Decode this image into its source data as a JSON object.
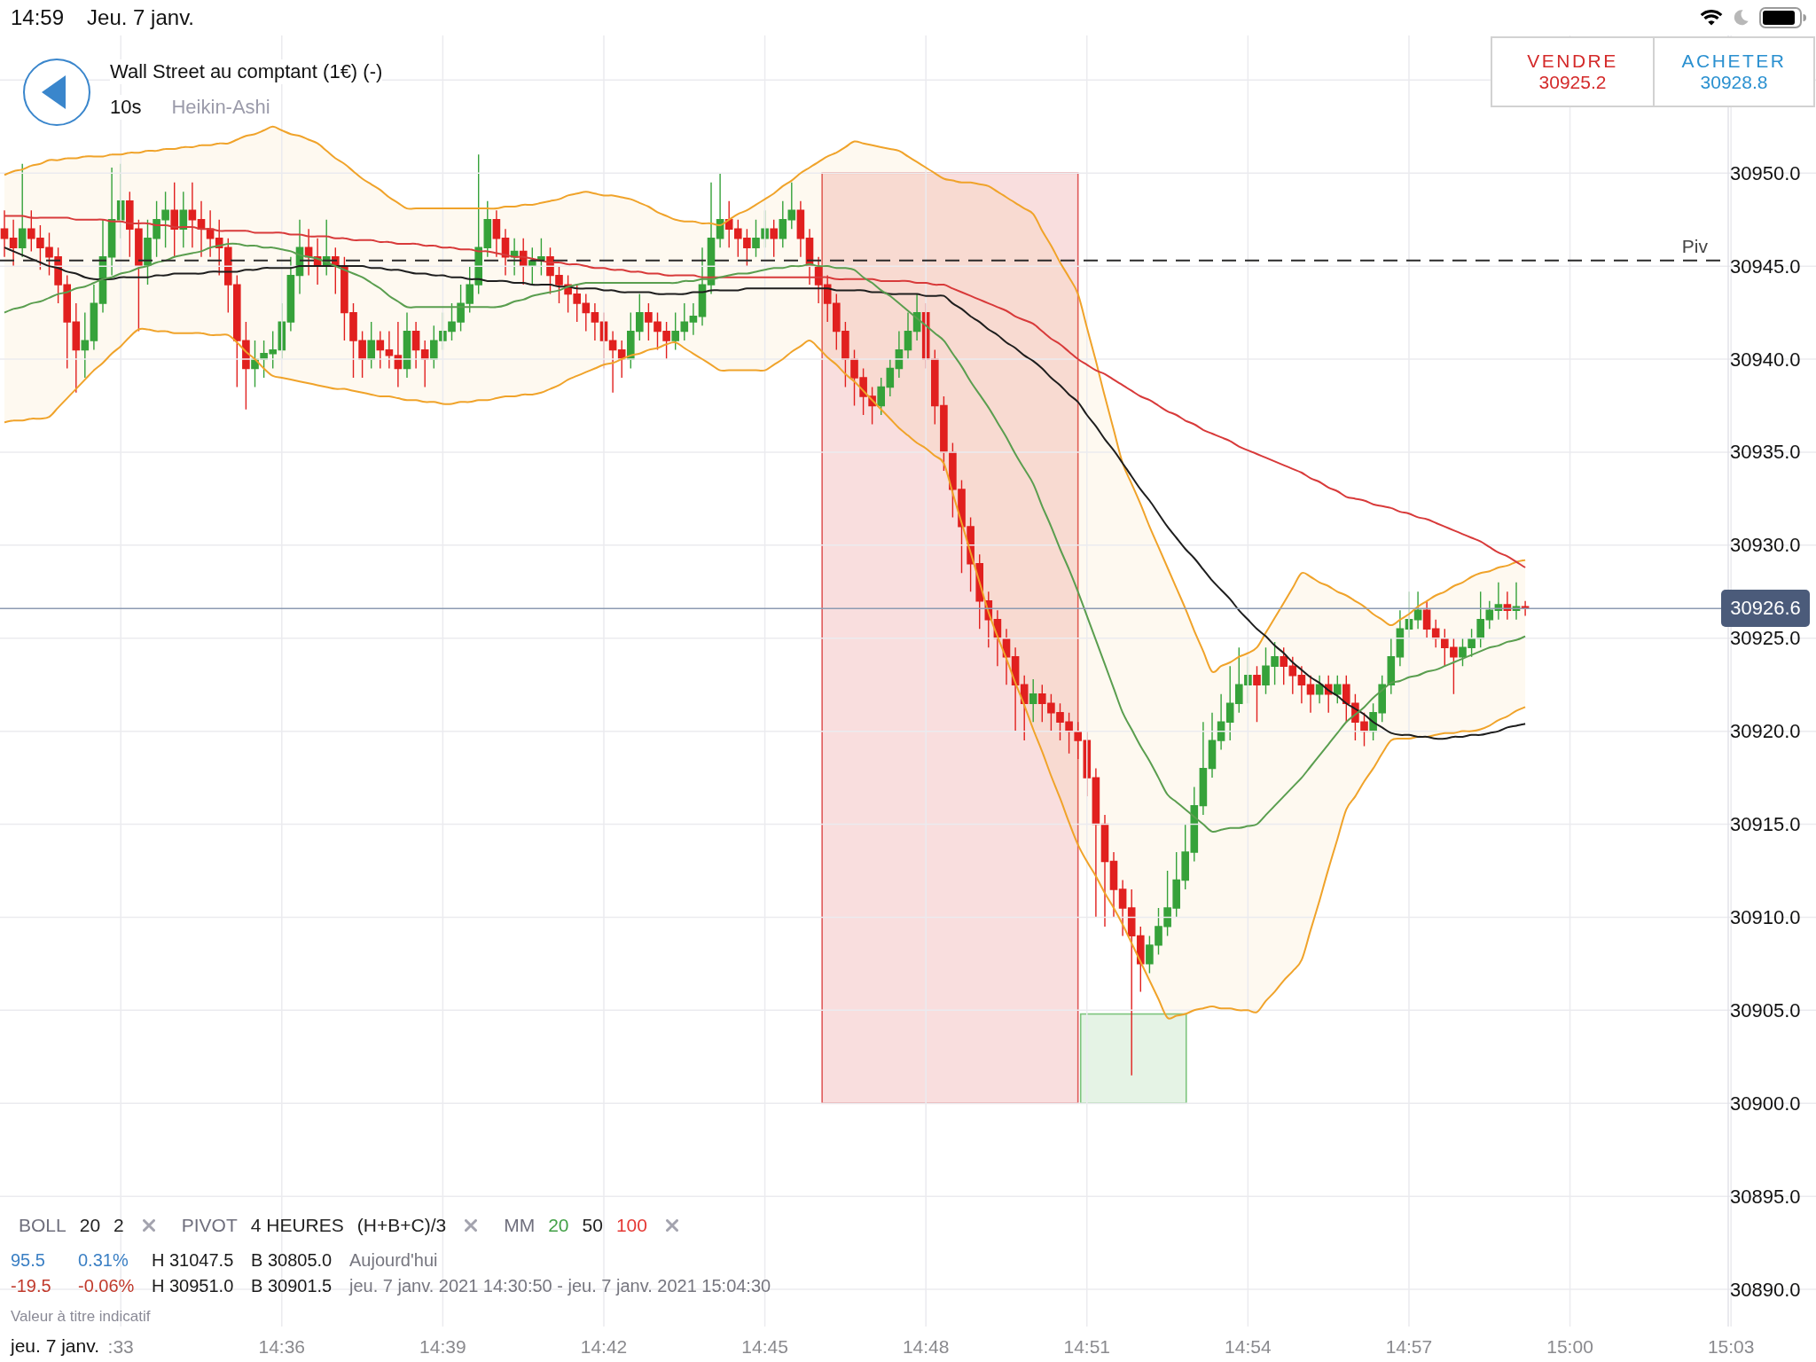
{
  "status_bar": {
    "time": "14:59",
    "date": "Jeu. 7 janv."
  },
  "instrument": {
    "title": "Wall Street au comptant (1€) (-)",
    "interval": "10s",
    "chart_type": "Heikin-Ashi"
  },
  "trade_buttons": [
    {
      "kind": "sell",
      "label": "VENDRE",
      "price": "30925.2"
    },
    {
      "kind": "buy",
      "label": "ACHETER",
      "price": "30928.8"
    }
  ],
  "chart": {
    "chart_data": {
      "type": "line",
      "grid": true,
      "categories": [
        null,
        null,
        null,
        null,
        null,
        null,
        null,
        null,
        null,
        null,
        null,
        null,
        null,
        ":33",
        null,
        null,
        null,
        null,
        null,
        null,
        null,
        null,
        null,
        null,
        null,
        null,
        null,
        null,
        null,
        null,
        null,
        "14:36",
        null,
        null,
        null,
        null,
        null,
        null,
        null,
        null,
        null,
        null,
        null,
        null,
        null,
        null,
        null,
        null,
        null,
        "14:39",
        null,
        null,
        null,
        null,
        null,
        null,
        null,
        null,
        null,
        null,
        null,
        null,
        null,
        null,
        null,
        null,
        null,
        "14:42",
        null,
        null,
        null,
        null,
        null,
        null,
        null,
        null,
        null,
        null,
        null,
        null,
        null,
        null,
        null,
        null,
        null,
        "14:45",
        null,
        null,
        null,
        null,
        null,
        null,
        null,
        null,
        null,
        null,
        null,
        null,
        null,
        null,
        null,
        null,
        null,
        "14:48",
        null,
        null,
        null,
        null,
        null,
        null,
        null,
        null,
        null,
        null,
        null,
        null,
        null,
        null,
        null,
        null,
        null,
        "14:51",
        null,
        null,
        null,
        null,
        null,
        null,
        null,
        null,
        null,
        null,
        null,
        null,
        null,
        null,
        null,
        null,
        null,
        "14:54",
        null,
        null,
        null,
        null,
        null,
        null,
        null,
        null,
        null,
        null,
        null,
        null,
        null,
        null,
        null,
        null,
        null,
        "14:57",
        null,
        null,
        null,
        null,
        null,
        null,
        null,
        null,
        null,
        null,
        null,
        null,
        null,
        null,
        null,
        null,
        null,
        "15:00",
        null,
        null,
        null,
        null,
        null,
        null,
        null,
        null,
        null,
        null,
        null,
        null,
        null,
        null,
        null,
        null,
        null,
        "15:03",
        null,
        null,
        null,
        null,
        null,
        null,
        null,
        null,
        null
      ],
      "ylim": [
        30888,
        30957.4
      ],
      "yticks": [
        {
          "value": 30950,
          "label": "30950.0"
        },
        {
          "value": 30945,
          "label": "30945.0"
        },
        {
          "value": 30940,
          "label": "30940.0"
        },
        {
          "value": 30935,
          "label": "30935.0"
        },
        {
          "value": 30930,
          "label": "30930.0"
        },
        {
          "value": 30925,
          "label": "30925.0"
        },
        {
          "value": 30920,
          "label": "30920.0"
        },
        {
          "value": 30915,
          "label": "30915.0"
        },
        {
          "value": 30910,
          "label": "30910.0"
        },
        {
          "value": 30905,
          "label": "30905.0"
        },
        {
          "value": 30900,
          "label": "30900.0"
        },
        {
          "value": 30895,
          "label": "30895.0"
        },
        {
          "value": 30890,
          "label": "30890.0"
        }
      ],
      "series": [
        {
          "color": "#f0a32a",
          "values": [
            30949.9,
            30950.1,
            30950.2,
            30950.4,
            30950.5,
            30950.7,
            30950.7,
            30950.8,
            30950.8,
            30950.9,
            30950.9,
            30950.9,
            30951.0,
            30951.0,
            30951.1,
            30951.1,
            30951.2,
            30951.2,
            30951.3,
            30951.3,
            30951.4,
            30951.4,
            30951.5,
            30951.5,
            30951.6,
            30951.6,
            30951.8,
            30952.0,
            30952.1,
            30952.3,
            30952.5,
            30952.3,
            30952.1,
            30952.0,
            30951.8,
            30951.6,
            30951.2,
            30950.8,
            30950.5,
            30950.1,
            30949.7,
            30949.4,
            30949.1,
            30948.7,
            30948.4,
            30948.1,
            30948.1,
            30948.1,
            30948.1,
            30948.1,
            30948.1,
            30948.1,
            30948.1,
            30948.1,
            30948.1,
            30948.1,
            30948.2,
            30948.2,
            30948.3,
            30948.3,
            30948.4,
            30948.5,
            30948.6,
            30948.8,
            30948.9,
            30949.0,
            30948.9,
            30948.8,
            30948.8,
            30948.7,
            30948.6,
            30948.4,
            30948.2,
            30947.9,
            30947.7,
            30947.5,
            30947.4,
            30947.4,
            30947.3,
            30947.3,
            30947.2,
            30947.5,
            30947.8,
            30948.0,
            30948.3,
            30948.6,
            30948.9,
            30949.3,
            30949.6,
            30950.0,
            30950.3,
            30950.6,
            30950.9,
            30951.1,
            30951.4,
            30951.7,
            30951.6,
            30951.5,
            30951.4,
            30951.3,
            30951.2,
            30950.9,
            30950.6,
            30950.3,
            30950.0,
            30949.7,
            30949.6,
            30949.5,
            30949.5,
            30949.4,
            30949.3,
            30949.0,
            30948.7,
            30948.4,
            30948.1,
            30947.8,
            30946.9,
            30946.1,
            30945.2,
            30944.4,
            30943.5,
            30941.7,
            30939.9,
            30938.0,
            30936.2,
            30934.4,
            30933.3,
            30932.2,
            30931.0,
            30929.9,
            30928.8,
            30927.7,
            30926.6,
            30925.4,
            30924.3,
            30923.2,
            30923.5,
            30923.7,
            30924.0,
            30924.2,
            30924.5,
            30925.3,
            30926.1,
            30926.9,
            30927.7,
            30928.5,
            30928.3,
            30928.0,
            30927.8,
            30927.5,
            30927.3,
            30927.0,
            30926.7,
            30926.3,
            30926.0,
            30925.7,
            30926.0,
            30926.3,
            30926.7,
            30927.0,
            30927.3,
            30927.5,
            30927.8,
            30928.0,
            30928.3,
            30928.5,
            30928.6,
            30928.8,
            30928.9,
            30929.1,
            30929.2,
            null,
            null,
            null,
            null,
            null,
            null,
            null,
            null,
            null,
            null,
            null,
            null,
            null,
            null,
            null,
            null,
            null,
            null,
            null,
            null,
            null,
            null,
            null,
            null,
            null,
            null,
            null,
            null,
            null,
            null,
            null,
            null
          ]
        },
        {
          "color": "#f0a32a",
          "values": [
            30936.6,
            30936.7,
            30936.7,
            30936.8,
            30936.8,
            30936.9,
            30937.4,
            30937.9,
            30938.4,
            30938.9,
            30939.4,
            30939.8,
            30940.3,
            30940.7,
            30941.2,
            30941.6,
            30941.6,
            30941.5,
            30941.5,
            30941.4,
            30941.4,
            30941.4,
            30941.4,
            30941.3,
            30941.3,
            30941.3,
            30940.9,
            30940.4,
            30940.0,
            30939.5,
            30939.1,
            30939.0,
            30938.9,
            30938.8,
            30938.7,
            30938.6,
            30938.5,
            30938.4,
            30938.4,
            30938.3,
            30938.2,
            30938.1,
            30938.0,
            30938.0,
            30937.9,
            30937.8,
            30937.8,
            30937.7,
            30937.7,
            30937.6,
            30937.6,
            30937.7,
            30937.7,
            30937.8,
            30937.8,
            30937.9,
            30938.0,
            30938.0,
            30938.1,
            30938.1,
            30938.2,
            30938.4,
            30938.6,
            30938.9,
            30939.1,
            30939.3,
            30939.5,
            30939.7,
            30939.8,
            30940.0,
            30940.2,
            30940.3,
            30940.5,
            30940.6,
            30940.8,
            30940.9,
            30940.6,
            30940.3,
            30940.0,
            30939.7,
            30939.4,
            30939.4,
            30939.4,
            30939.4,
            30939.4,
            30939.4,
            30939.7,
            30940.0,
            30940.4,
            30940.7,
            30941.0,
            30940.6,
            30940.1,
            30939.7,
            30939.2,
            30938.8,
            30938.3,
            30937.8,
            30937.3,
            30936.8,
            30936.3,
            30935.9,
            30935.5,
            30935.2,
            30934.8,
            30934.4,
            30932.8,
            30931.2,
            30929.6,
            30928.0,
            30926.4,
            30925.1,
            30923.9,
            30922.6,
            30921.4,
            30920.1,
            30918.9,
            30917.6,
            30916.4,
            30915.1,
            30913.9,
            30913.0,
            30912.2,
            30911.3,
            30910.5,
            30909.6,
            30908.6,
            30907.6,
            30906.6,
            30905.6,
            30904.6,
            30904.7,
            30904.8,
            30905.0,
            30905.1,
            30905.2,
            30905.1,
            30905.1,
            30905.0,
            30905.0,
            30904.9,
            30905.5,
            30906.0,
            30906.6,
            30907.1,
            30907.7,
            30909.3,
            30910.9,
            30912.6,
            30914.2,
            30915.8,
            30916.5,
            30917.3,
            30918.0,
            30918.8,
            30919.5,
            30919.6,
            30919.6,
            30919.7,
            30919.7,
            30919.8,
            30919.9,
            30919.9,
            30920.0,
            30920.0,
            30920.1,
            30920.3,
            30920.6,
            30920.8,
            30921.1,
            30921.3,
            null,
            null,
            null,
            null,
            null,
            null,
            null,
            null,
            null,
            null,
            null,
            null,
            null,
            null,
            null,
            null,
            null,
            null,
            null,
            null,
            null,
            null,
            null,
            null,
            null,
            null,
            null,
            null,
            null,
            null,
            null,
            null
          ]
        },
        {
          "color": "#d83a3a",
          "values": [
            30947.7,
            30947.7,
            30947.7,
            30947.6,
            30947.6,
            30947.6,
            30947.6,
            30947.6,
            30947.5,
            30947.5,
            30947.5,
            30947.5,
            30947.4,
            30947.4,
            30947.3,
            30947.3,
            30947.3,
            30947.2,
            30947.2,
            30947.1,
            30947.1,
            30947.1,
            30947.0,
            30947.0,
            30946.9,
            30946.9,
            30946.9,
            30946.9,
            30946.8,
            30946.8,
            30946.8,
            30946.8,
            30946.7,
            30946.7,
            30946.6,
            30946.6,
            30946.6,
            30946.5,
            30946.5,
            30946.4,
            30946.4,
            30946.4,
            30946.3,
            30946.3,
            30946.2,
            30946.2,
            30946.2,
            30946.1,
            30946.1,
            30946.0,
            30946.0,
            30945.9,
            30945.9,
            30945.8,
            30945.8,
            30945.7,
            30945.6,
            30945.5,
            30945.5,
            30945.4,
            30945.3,
            30945.2,
            30945.2,
            30945.1,
            30945.1,
            30945.0,
            30944.9,
            30944.9,
            30944.8,
            30944.8,
            30944.7,
            30944.7,
            30944.6,
            30944.6,
            30944.5,
            30944.5,
            30944.5,
            30944.5,
            30944.4,
            30944.4,
            30944.4,
            30944.4,
            30944.4,
            30944.4,
            30944.4,
            30944.4,
            30944.4,
            30944.4,
            30944.4,
            30944.4,
            30944.4,
            30944.4,
            30944.4,
            30944.3,
            30944.3,
            30944.3,
            30944.3,
            30944.3,
            30944.2,
            30944.2,
            30944.2,
            30944.2,
            30944.1,
            30944.1,
            30944.0,
            30944.0,
            30943.8,
            30943.6,
            30943.4,
            30943.2,
            30943.0,
            30942.8,
            30942.6,
            30942.3,
            30942.1,
            30941.9,
            30941.5,
            30941.1,
            30940.8,
            30940.4,
            30940.0,
            30939.7,
            30939.4,
            30939.2,
            30938.9,
            30938.6,
            30938.3,
            30938.0,
            30937.8,
            30937.5,
            30937.2,
            30937.0,
            30936.7,
            30936.5,
            30936.2,
            30936.0,
            30935.8,
            30935.6,
            30935.3,
            30935.1,
            30934.9,
            30934.7,
            30934.5,
            30934.3,
            30934.1,
            30933.9,
            30933.6,
            30933.4,
            30933.1,
            30932.9,
            30932.6,
            30932.5,
            30932.4,
            30932.2,
            30932.1,
            30932.0,
            30931.8,
            30931.7,
            30931.5,
            30931.4,
            30931.2,
            30931.0,
            30930.8,
            30930.6,
            30930.4,
            30930.2,
            30929.9,
            30929.6,
            30929.4,
            30929.1,
            30928.8,
            null,
            null,
            null,
            null,
            null,
            null,
            null,
            null,
            null,
            null,
            null,
            null,
            null,
            null,
            null,
            null,
            null,
            null,
            null,
            null,
            null,
            null,
            null,
            null,
            null,
            null,
            null,
            null,
            null,
            null,
            null,
            null
          ]
        },
        {
          "color": "#1e1e1e",
          "values": [
            30946.0,
            30945.8,
            30945.6,
            30945.4,
            30945.2,
            30945.0,
            30944.9,
            30944.7,
            30944.6,
            30944.4,
            30944.3,
            30944.3,
            30944.3,
            30944.4,
            30944.4,
            30944.4,
            30944.4,
            30944.5,
            30944.5,
            30944.6,
            30944.6,
            30944.6,
            30944.6,
            30944.7,
            30944.7,
            30944.7,
            30944.7,
            30944.8,
            30944.8,
            30944.9,
            30944.9,
            30944.9,
            30944.9,
            30945.0,
            30945.0,
            30945.0,
            30945.0,
            30945.0,
            30945.0,
            30945.0,
            30945.0,
            30944.9,
            30944.9,
            30944.8,
            30944.8,
            30944.7,
            30944.6,
            30944.6,
            30944.5,
            30944.5,
            30944.4,
            30944.4,
            30944.3,
            30944.3,
            30944.2,
            30944.2,
            30944.2,
            30944.1,
            30944.1,
            30944.0,
            30944.0,
            30944.0,
            30943.9,
            30943.9,
            30943.8,
            30943.8,
            30943.8,
            30943.7,
            30943.7,
            30943.6,
            30943.6,
            30943.6,
            30943.6,
            30943.5,
            30943.5,
            30943.5,
            30943.5,
            30943.6,
            30943.6,
            30943.7,
            30943.7,
            30943.7,
            30943.7,
            30943.8,
            30943.8,
            30943.8,
            30943.8,
            30943.8,
            30943.8,
            30943.8,
            30943.8,
            30943.8,
            30943.8,
            30943.7,
            30943.7,
            30943.7,
            30943.7,
            30943.6,
            30943.6,
            30943.5,
            30943.5,
            30943.5,
            30943.5,
            30943.4,
            30943.4,
            30943.4,
            30943.0,
            30942.7,
            30942.3,
            30942.0,
            30941.6,
            30941.3,
            30940.9,
            30940.6,
            30940.2,
            30939.9,
            30939.5,
            30939.0,
            30938.6,
            30938.1,
            30937.7,
            30937.0,
            30936.4,
            30935.7,
            30935.1,
            30934.4,
            30933.7,
            30933.0,
            30932.4,
            30931.7,
            30931.0,
            30930.4,
            30929.8,
            30929.3,
            30928.7,
            30928.1,
            30927.6,
            30927.1,
            30926.5,
            30926.0,
            30925.5,
            30925.1,
            30924.6,
            30924.2,
            30923.7,
            30923.3,
            30922.9,
            30922.6,
            30922.2,
            30921.9,
            30921.5,
            30921.2,
            30920.9,
            30920.5,
            30920.2,
            30919.9,
            30919.8,
            30919.8,
            30919.7,
            30919.7,
            30919.6,
            30919.6,
            30919.7,
            30919.7,
            30919.8,
            30919.8,
            30919.9,
            30920.0,
            30920.2,
            30920.3,
            30920.4,
            null,
            null,
            null,
            null,
            null,
            null,
            null,
            null,
            null,
            null,
            null,
            null,
            null,
            null,
            null,
            null,
            null,
            null,
            null,
            null,
            null,
            null,
            null,
            null,
            null,
            null,
            null,
            null,
            null,
            null,
            null,
            null
          ]
        },
        {
          "color": "#5a9e4f",
          "values": [
            30942.5,
            30942.7,
            30942.8,
            30943.0,
            30943.1,
            30943.3,
            30943.5,
            30943.6,
            30943.8,
            30943.9,
            30944.1,
            30944.3,
            30944.4,
            30944.6,
            30944.7,
            30944.9,
            30945.0,
            30945.2,
            30945.3,
            30945.5,
            30945.6,
            30945.7,
            30945.8,
            30946.0,
            30946.1,
            30946.2,
            30946.2,
            30946.1,
            30946.1,
            30946.0,
            30946.0,
            30945.9,
            30945.8,
            30945.6,
            30945.5,
            30945.4,
            30945.2,
            30945.0,
            30944.8,
            30944.6,
            30944.4,
            30944.1,
            30943.8,
            30943.4,
            30943.1,
            30942.8,
            30942.8,
            30942.8,
            30942.8,
            30942.8,
            30942.8,
            30942.8,
            30942.8,
            30942.8,
            30942.8,
            30942.8,
            30942.9,
            30943.1,
            30943.2,
            30943.4,
            30943.5,
            30943.6,
            30943.7,
            30943.9,
            30944.0,
            30944.1,
            30944.1,
            30944.1,
            30944.1,
            30944.1,
            30944.1,
            30944.1,
            30944.1,
            30944.1,
            30944.1,
            30944.1,
            30944.2,
            30944.2,
            30944.3,
            30944.3,
            30944.4,
            30944.5,
            30944.6,
            30944.6,
            30944.7,
            30944.8,
            30944.9,
            30944.9,
            30945.0,
            30945.0,
            30945.1,
            30945.0,
            30945.0,
            30944.9,
            30944.9,
            30944.8,
            30944.4,
            30944.1,
            30943.7,
            30943.4,
            30943.0,
            30942.6,
            30942.2,
            30941.8,
            30941.4,
            30941.0,
            30940.3,
            30939.6,
            30938.8,
            30938.1,
            30937.4,
            30936.6,
            30935.8,
            30934.9,
            30934.1,
            30933.3,
            30932.1,
            30931.0,
            30929.8,
            30928.7,
            30927.5,
            30926.2,
            30924.9,
            30923.6,
            30922.3,
            30921.0,
            30920.1,
            30919.2,
            30918.4,
            30917.5,
            30916.6,
            30916.2,
            30915.8,
            30915.4,
            30915.0,
            30914.6,
            30914.7,
            30914.8,
            30914.8,
            30914.9,
            30915.0,
            30915.5,
            30916.0,
            30916.5,
            30917.0,
            30917.5,
            30918.1,
            30918.7,
            30919.3,
            30919.9,
            30920.5,
            30920.9,
            30921.3,
            30921.8,
            30922.2,
            30922.6,
            30922.7,
            30922.9,
            30923.0,
            30923.2,
            30923.3,
            30923.5,
            30923.7,
            30923.9,
            30924.1,
            30924.3,
            30924.5,
            30924.6,
            30924.8,
            30924.9,
            30925.1,
            null,
            null,
            null,
            null,
            null,
            null,
            null,
            null,
            null,
            null,
            null,
            null,
            null,
            null,
            null,
            null,
            null,
            null,
            null,
            null,
            null,
            null,
            null,
            null,
            null,
            null,
            null,
            null,
            null,
            null,
            null,
            null
          ]
        }
      ],
      "ref_lines": [
        {
          "axis": "y",
          "value": 30945.3,
          "label": "Piv"
        },
        {
          "axis": "y",
          "value": 30926.6,
          "label": "30926.6"
        }
      ]
    },
    "zones": [
      {
        "color": "#e05a5a"
      },
      {
        "color": "#7cc47c"
      }
    ]
  },
  "indicators": [
    {
      "name": "BOLL",
      "params": [
        {
          "text": "20"
        },
        {
          "text": "2"
        }
      ]
    },
    {
      "name": "PIVOT",
      "params": [
        {
          "text": "4 HEURES"
        },
        {
          "text": "(H+B+C)/3"
        }
      ]
    },
    {
      "name": "MM",
      "params": [
        {
          "text": "20",
          "color": "#43a047"
        },
        {
          "text": "50",
          "color": "#222222"
        },
        {
          "text": "100",
          "color": "#e53935"
        }
      ]
    }
  ],
  "stats": [
    {
      "negative": false,
      "change": "95.5",
      "percent": "0.31%",
      "high": "H 31047.5",
      "low": "B 30805.0",
      "period": "Aujourd'hui"
    },
    {
      "negative": true,
      "change": "-19.5",
      "percent": "-0.06%",
      "high": "H 30951.0",
      "low": "B 30901.5",
      "period": "jeu. 7 janv. 2021 14:30:50 - jeu. 7 janv. 2021 15:04:30"
    }
  ],
  "disclaimer": "Valeur à titre indicatif",
  "x_axis_date": "jeu. 7 janv."
}
